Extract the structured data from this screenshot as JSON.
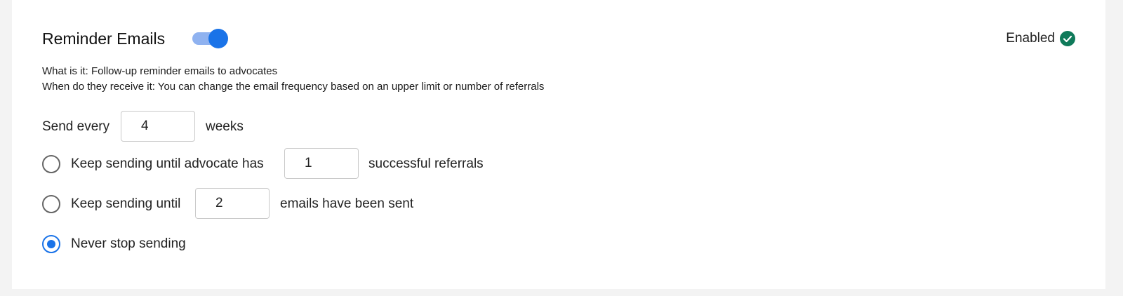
{
  "section": {
    "title": "Reminder Emails",
    "toggle_on": true,
    "status_label": "Enabled",
    "status_icon": "check-circle-icon",
    "description_line1": "What is it: Follow-up reminder emails to advocates",
    "description_line2": "When do they receive it: You can change the email frequency based on an upper limit or number of referrals"
  },
  "frequency": {
    "prefix": "Send every",
    "value": "4",
    "suffix": "weeks"
  },
  "options": [
    {
      "prefix": "Keep sending until advocate has",
      "value": "1",
      "suffix": "successful referrals",
      "selected": false
    },
    {
      "prefix": "Keep sending until",
      "value": "2",
      "suffix": "emails have been sent",
      "selected": false
    },
    {
      "label": "Never stop sending",
      "selected": true
    }
  ],
  "colors": {
    "accent": "#1a73e8",
    "toggle_track": "#8fb2f0",
    "success": "#0f7a5a"
  }
}
